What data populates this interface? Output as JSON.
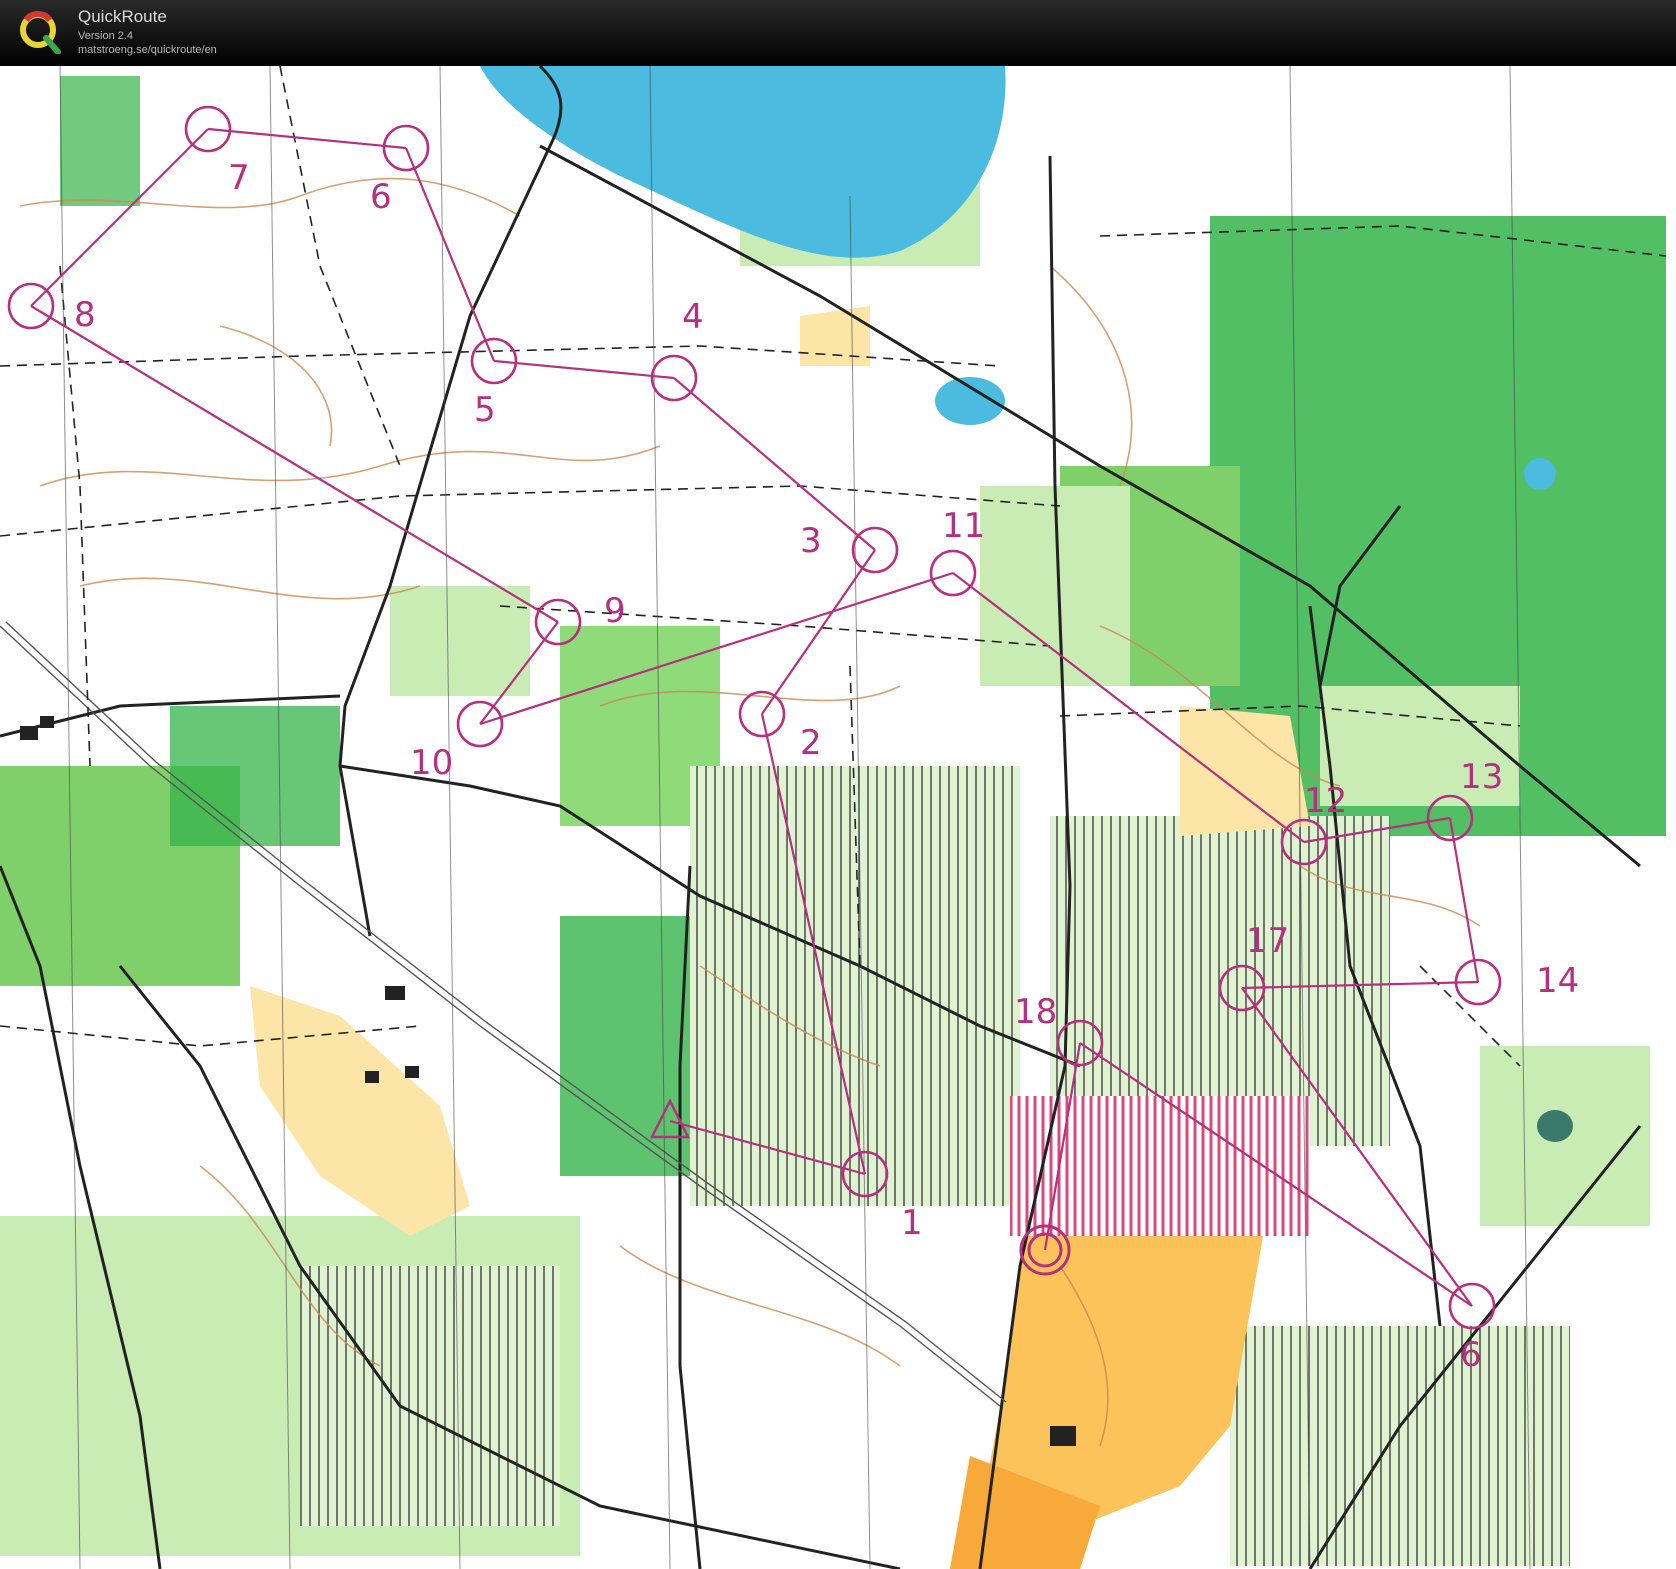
{
  "app": {
    "title": "QuickRoute",
    "version": "Version 2.4",
    "url": "matstroeng.se/quickroute/en"
  },
  "colors": {
    "course": "#b5307e",
    "forest_light": "#c8ecb4",
    "forest_dark": "#34b44a",
    "open_land": "#fbc35a",
    "water": "#4cbbe0",
    "contour": "#c98a52",
    "track": "#222222"
  },
  "course": {
    "controls": [
      {
        "label": "1"
      },
      {
        "label": "2"
      },
      {
        "label": "3"
      },
      {
        "label": "4"
      },
      {
        "label": "5"
      },
      {
        "label": "6"
      },
      {
        "label": "7"
      },
      {
        "label": "8"
      },
      {
        "label": "9"
      },
      {
        "label": "10"
      },
      {
        "label": "11"
      },
      {
        "label": "12"
      },
      {
        "label": "13"
      },
      {
        "label": "14"
      },
      {
        "label": "6"
      },
      {
        "label": "17"
      },
      {
        "label": "18"
      }
    ]
  }
}
